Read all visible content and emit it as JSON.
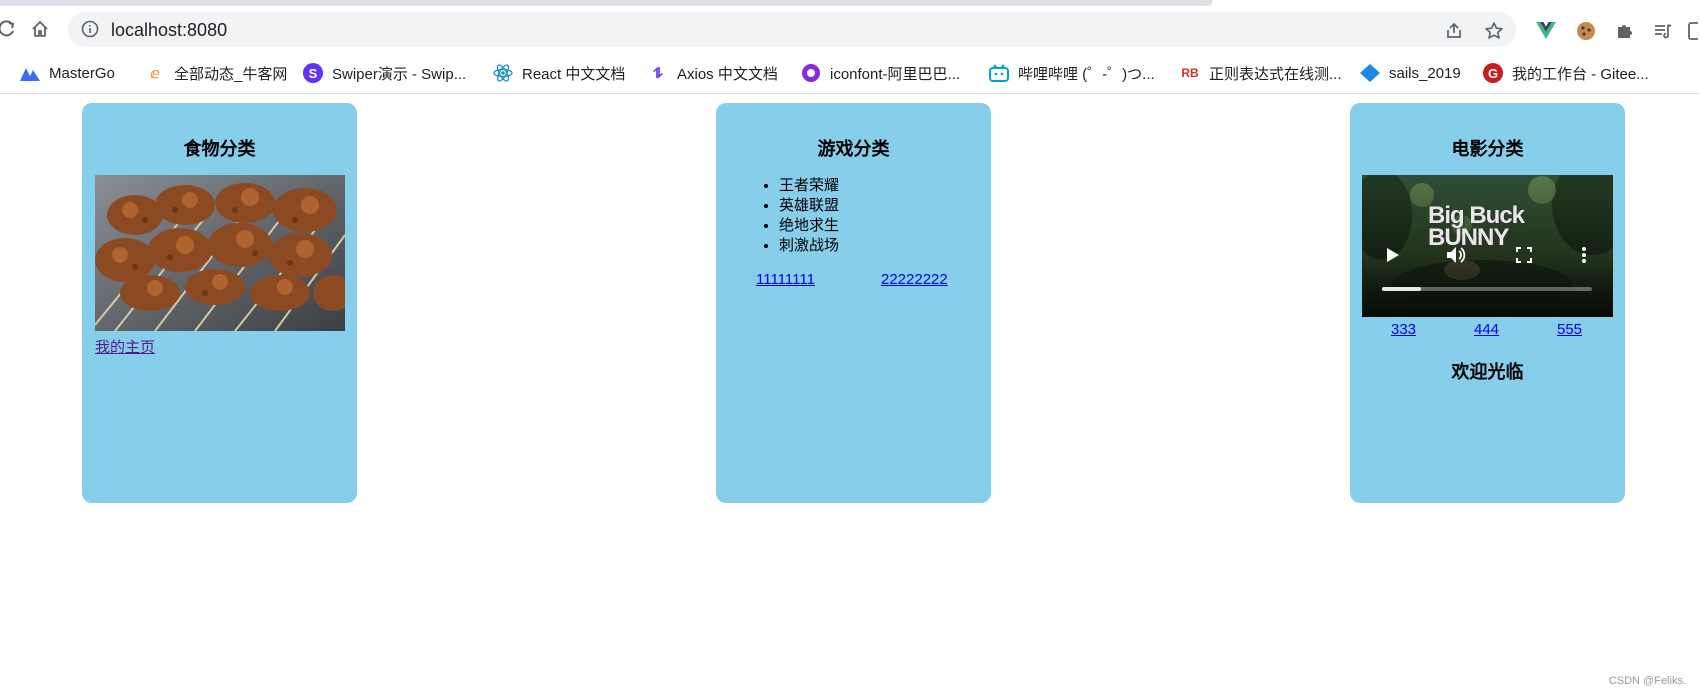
{
  "browser": {
    "url": "localhost:8080",
    "bookmarks": [
      {
        "label": "MasterGo",
        "icon": "mastergo-icon",
        "color": "#3b6cf6"
      },
      {
        "label": "全部动态_牛客网",
        "icon": "nowcoder-icon",
        "color": "#f57c00"
      },
      {
        "label": "Swiper演示 - Swip...",
        "icon": "swiper-icon",
        "color": "#6332f6"
      },
      {
        "label": "React 中文文档",
        "icon": "react-icon",
        "color": "#61dafb"
      },
      {
        "label": "Axios 中文文档",
        "icon": "axios-icon",
        "color": "#5a29e4"
      },
      {
        "label": "iconfont-阿里巴巴...",
        "icon": "iconfont-icon",
        "color": "#8a2be2"
      },
      {
        "label": "哔哩哔哩 (゜-゜)つ...",
        "icon": "bilibili-icon",
        "color": "#00a1d6"
      },
      {
        "label": "正则表达式在线测...",
        "icon": "regex-icon",
        "color": "#d32f2f"
      },
      {
        "label": "sails_2019",
        "icon": "sails-icon",
        "color": "#1e88e5"
      },
      {
        "label": "我的工作台 - Gitee...",
        "icon": "gitee-icon",
        "color": "#c71d23"
      }
    ]
  },
  "cards": {
    "food": {
      "title": "食物分类",
      "link": "我的主页"
    },
    "game": {
      "title": "游戏分类",
      "items": [
        "王者荣耀",
        "英雄联盟",
        "绝地求生",
        "刺激战场"
      ],
      "links": [
        "11111111",
        "22222222"
      ]
    },
    "movie": {
      "title": "电影分类",
      "video_title": "Big Buck BUNNY",
      "links": [
        "333",
        "444",
        "555"
      ],
      "welcome": "欢迎光临"
    }
  },
  "colors": {
    "card_bg": "#87ceeb",
    "link": "#0000ee",
    "visited_link": "#551a8b"
  },
  "watermark": "CSDN @Feliks."
}
